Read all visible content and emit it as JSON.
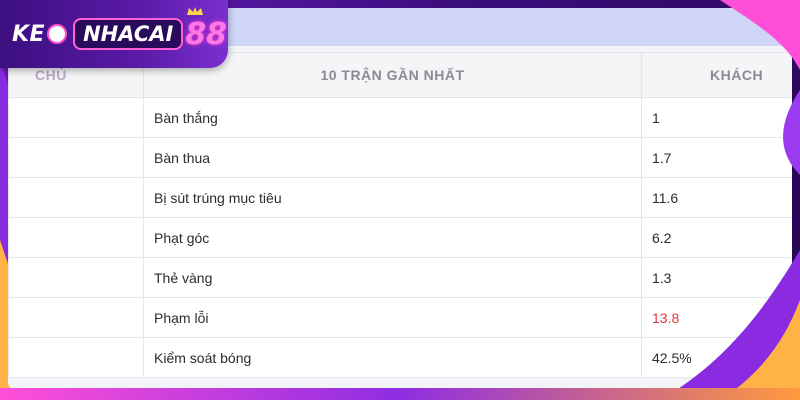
{
  "logo": {
    "part1": "KE",
    "part2": "NHACAI",
    "part3": "88"
  },
  "table": {
    "headers": [
      "CHỦ",
      "10 TRẬN GẦN NHẤT",
      "KHÁCH"
    ],
    "rows": [
      {
        "stat": "Bàn thắng",
        "away": "1"
      },
      {
        "stat": "Bàn thua",
        "away": "1.7"
      },
      {
        "stat": "Bị sút trúng mục tiêu",
        "away": "11.6"
      },
      {
        "stat": "Phạt góc",
        "away": "6.2"
      },
      {
        "stat": "Thẻ vàng",
        "away": "1.3"
      },
      {
        "stat": "Phạm lỗi",
        "away": "13.8"
      },
      {
        "stat": "Kiểm soát bóng",
        "away": "42.5%"
      }
    ]
  },
  "colors": {
    "highlight_value": "#d9383b",
    "frame_purple": "#6d1fc2",
    "accent_pink": "#ff4fd8"
  }
}
